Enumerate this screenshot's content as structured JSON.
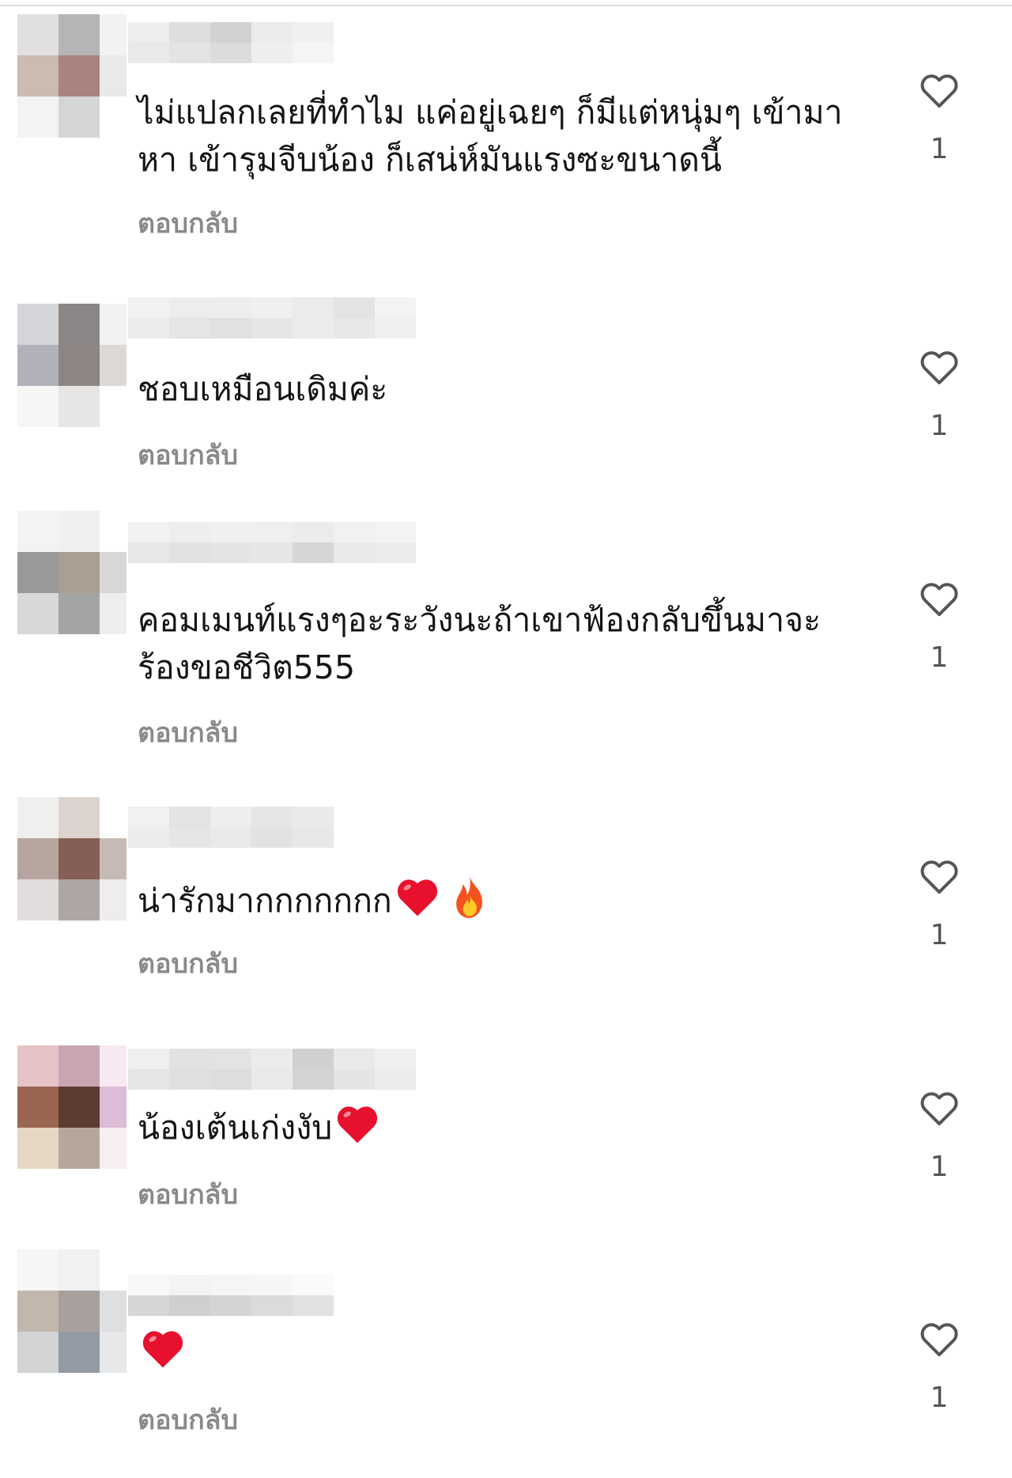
{
  "reply_label": "ตอบกลับ",
  "like_icon": "heart-outline-icon",
  "colors": {
    "text": "#141414",
    "reply": "#8a8a8a",
    "count": "#555555",
    "heart_emoji": "#e8112d",
    "divider": "#dcdcdc"
  },
  "comments": [
    {
      "text": "ไม่แปลกเลยที่ทำไม แค่อยู่เฉยๆ ก็มีแต่หนุ่มๆ เข้ามาหา เข้ารุมจีบน้อง ก็เสน่ห์มันแรงซะขนาดนี้",
      "likes": "1"
    },
    {
      "text": "ชอบเหมือนเดิมค่ะ",
      "likes": "1"
    },
    {
      "text": "คอมเมนท์แรงๆอะระวังนะถ้าเขาฟ้องกลับขึ้นมาจะร้องขอชีวิต555",
      "likes": "1"
    },
    {
      "text": "น่ารักมากกกกกกก",
      "emojis": [
        "red-heart",
        "fire"
      ],
      "likes": "1"
    },
    {
      "text": "น้องเต้นเก่งงับ",
      "emojis": [
        "red-heart"
      ],
      "likes": "1"
    },
    {
      "text": "",
      "emojis": [
        "red-heart"
      ],
      "likes": "1"
    }
  ]
}
